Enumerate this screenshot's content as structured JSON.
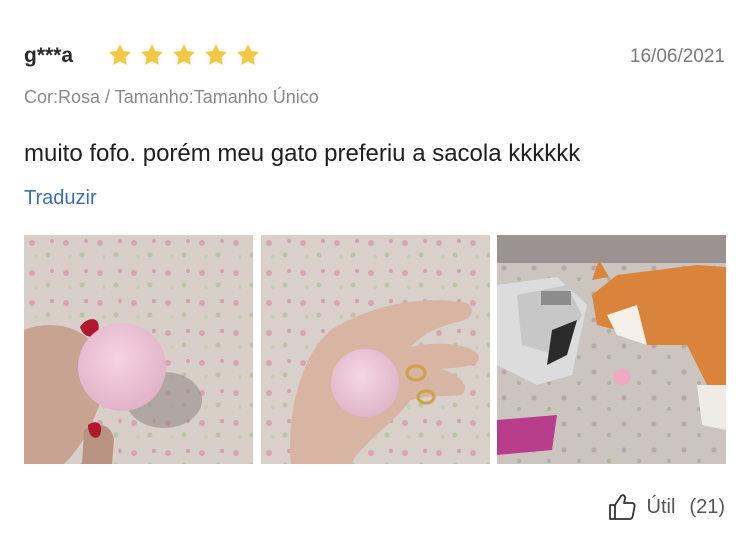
{
  "review": {
    "reviewer": "g***a",
    "rating": 5,
    "date": "16/06/2021",
    "variant": "Cor:Rosa / Tamanho:Tamanho Único",
    "text": "muito fofo. porém meu gato preferiu a sacola kkkkkk",
    "translate_label": "Traduzir"
  },
  "photos": [
    {
      "icon": "photo-thumbnail"
    },
    {
      "icon": "photo-thumbnail"
    },
    {
      "icon": "photo-thumbnail"
    }
  ],
  "helpful": {
    "label": "Útil",
    "count": "(21)"
  },
  "colors": {
    "star": "#f6c744",
    "link": "#3d6db1",
    "date": "#7a7a7a",
    "variant": "#8a8a8a"
  }
}
